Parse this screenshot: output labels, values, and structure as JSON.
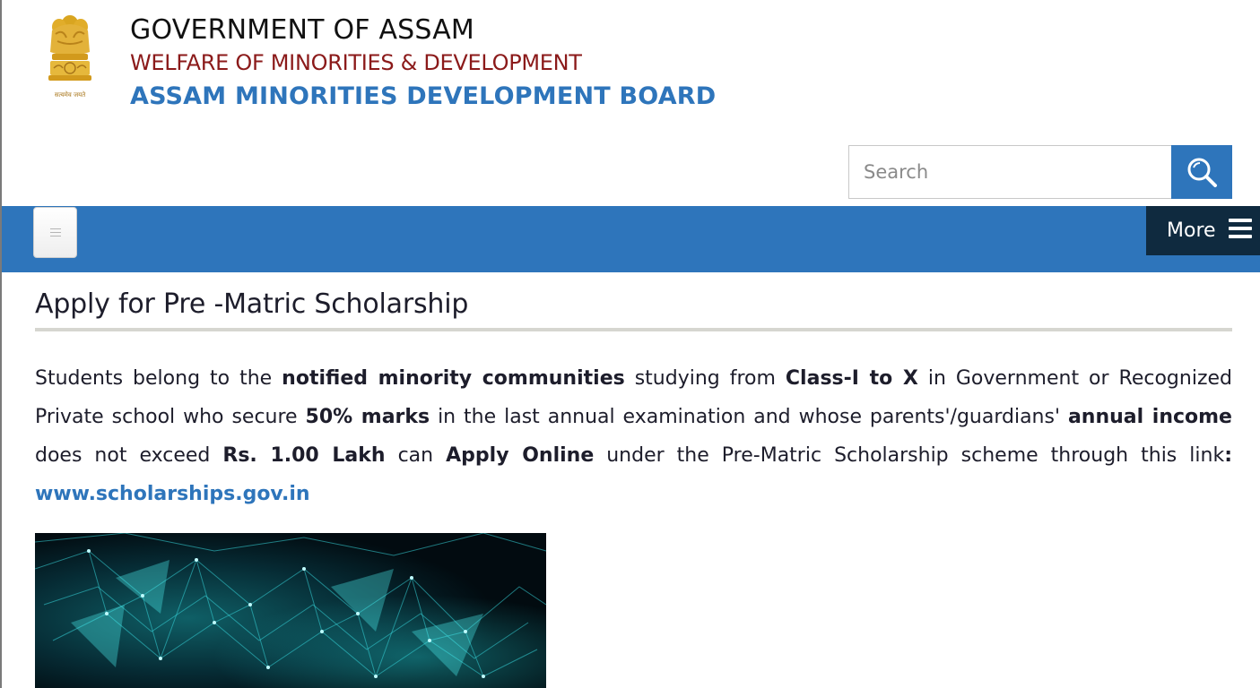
{
  "header": {
    "line1": "GOVERNMENT OF ASSAM",
    "line2": "WELFARE OF MINORITIES & DEVELOPMENT",
    "line3": "ASSAM MINORITIES DEVELOPMENT BOARD",
    "emblem_icon": "national-emblem-icon",
    "emblem_motto": "सत्यमेव जयते"
  },
  "search": {
    "placeholder": "Search",
    "value": "",
    "icon": "search-icon"
  },
  "nav": {
    "toggle_icon": "hamburger-icon",
    "more_label": "More",
    "more_icon": "menu-bars-icon"
  },
  "content": {
    "title": "Apply for Pre -Matric Scholarship",
    "paragraph": {
      "t1": "Students belong to the ",
      "b1": "notified minority communities",
      "t2": " studying from ",
      "b2": "Class-I to X",
      "t3": " in Government or Recognized Private school who secure ",
      "b3": "50% marks",
      "t4": " in the last annual examination and whose parents'/guardians' ",
      "b4": "annual income",
      "t5": " does not exceed ",
      "b5": "Rs. 1.00 Lakh",
      "t6": " can ",
      "b6": "Apply Online",
      "t7": " under the Pre-Matric Scholarship scheme through this link",
      "b7": ":",
      "link": "www.scholarships.gov.in"
    },
    "image_icon": "network-banner-image"
  },
  "colors": {
    "brand_blue": "#2e75bb",
    "maroon": "#8b1a1a",
    "dark_navy": "#0f2a3f",
    "text": "#1d1d2b"
  }
}
